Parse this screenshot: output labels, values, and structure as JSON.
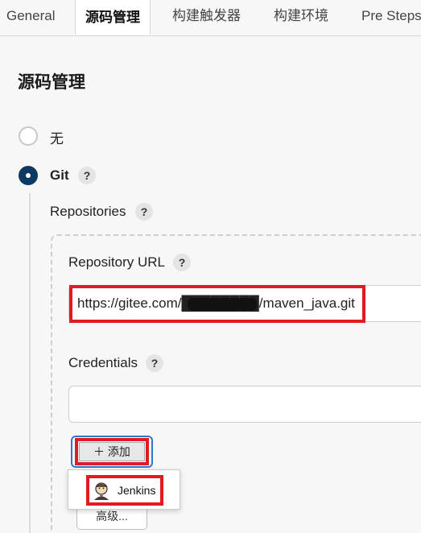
{
  "tabs": [
    {
      "label": "General"
    },
    {
      "label": "源码管理",
      "active": true
    },
    {
      "label": "构建触发器"
    },
    {
      "label": "构建环境"
    },
    {
      "label": "Pre Steps"
    }
  ],
  "section": {
    "title": "源码管理"
  },
  "scm_options": [
    {
      "label": "无",
      "selected": false
    },
    {
      "label": "Git",
      "selected": true,
      "help": "?"
    }
  ],
  "repositories": {
    "label": "Repositories",
    "help": "?"
  },
  "repository_url": {
    "label": "Repository URL",
    "help": "?",
    "value": "https://gitee.com/████████/maven_java.git"
  },
  "credentials": {
    "label": "Credentials",
    "help": "?",
    "value": ""
  },
  "add_button": {
    "label": "＋ 添加"
  },
  "add_menu": {
    "items": [
      {
        "label": "Jenkins",
        "icon": "jenkins-butler-icon"
      }
    ]
  },
  "advanced_button": {
    "label": "高级..."
  },
  "colors": {
    "accent": "#0d3a63",
    "highlight": "#e01b24",
    "focus": "#2f77c9"
  }
}
